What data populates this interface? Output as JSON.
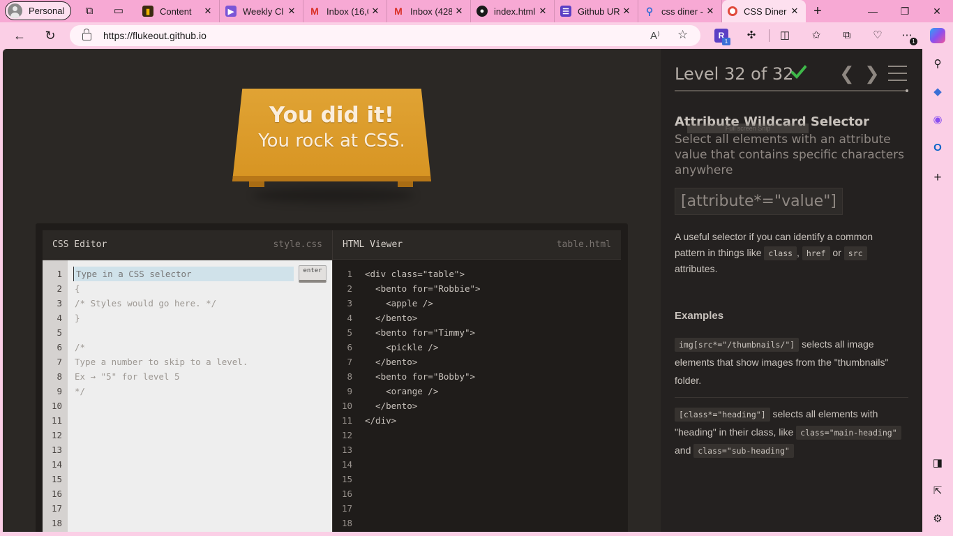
{
  "browser": {
    "profile_label": "Personal",
    "tabs": [
      {
        "label": "Content",
        "favicon": "chart-icon",
        "color": "#3a2a12",
        "active": false
      },
      {
        "label": "Weekly Cl",
        "favicon": "clipchamp-icon",
        "color": "#7a55d6",
        "active": false
      },
      {
        "label": "Inbox (16,0",
        "favicon": "gmail-icon",
        "color": "#ffffff",
        "active": false
      },
      {
        "label": "Inbox (428",
        "favicon": "gmail-icon",
        "color": "#ffffff",
        "active": false
      },
      {
        "label": "index.html",
        "favicon": "github-icon",
        "color": "#1a1a1a",
        "active": false
      },
      {
        "label": "Github UR",
        "favicon": "form-icon",
        "color": "#5b3fc4",
        "active": false
      },
      {
        "label": "css diner -",
        "favicon": "search-icon",
        "color": "#3b6fd6",
        "active": false
      },
      {
        "label": "CSS Diner",
        "favicon": "plate-icon",
        "color": "#e04a3c",
        "active": true
      }
    ],
    "url": "https://flukeout.github.io",
    "extension_badge": "1",
    "more_badge": "1"
  },
  "game": {
    "win_line1": "You did it!",
    "win_line2": "You rock at CSS."
  },
  "css_editor": {
    "title": "CSS Editor",
    "file": "style.css",
    "placeholder": "Type in a CSS selector",
    "enter_label": "enter",
    "lines": [
      "{",
      "/* Styles would go here. */",
      "}",
      "",
      "/*",
      "Type a number to skip to a level.",
      "Ex → \"5\" for level 5",
      "*/"
    ],
    "line_numbers": [
      "1",
      "2",
      "3",
      "4",
      "5",
      "6",
      "7",
      "8",
      "9",
      "10",
      "11",
      "12",
      "13",
      "14",
      "15",
      "16",
      "17",
      "18"
    ]
  },
  "html_viewer": {
    "title": "HTML Viewer",
    "file": "table.html",
    "lines": [
      "<div class=\"table\">",
      "  <bento for=\"Robbie\">",
      "    <apple />",
      "  </bento>",
      "  <bento for=\"Timmy\">",
      "    <pickle />",
      "  </bento>",
      "  <bento for=\"Bobby\">",
      "    <orange />",
      "  </bento>",
      "</div>"
    ],
    "line_numbers": [
      "1",
      "2",
      "3",
      "4",
      "5",
      "6",
      "7",
      "8",
      "9",
      "10",
      "11",
      "12",
      "13",
      "14",
      "15",
      "16",
      "17",
      "18"
    ]
  },
  "sidebar": {
    "level_title": "Level 32 of 32",
    "selector_name": "Attribute Wildcard Selector",
    "selector_title": "Select all elements with an attribute value that contains specific characters anywhere",
    "snip_overlay": "Full screen Snip",
    "syntax": "[attribute*=\"value\"]",
    "hint_parts": [
      "A useful selector if you can identify a common pattern in things like",
      "class",
      ",",
      "href",
      "or",
      "src",
      "attributes."
    ],
    "examples_heading": "Examples",
    "example1_code": "img[src*=\"/thumbnails/\"]",
    "example1_text": "selects all image elements that show images from the \"thumbnails\" folder.",
    "example2_code": "[class*=\"heading\"]",
    "example2_text": "selects all elements with \"heading\" in their class, like",
    "example2_code2": "class=\"main-heading\"",
    "example2_and": "and",
    "example2_code3": "class=\"sub-heading\""
  }
}
